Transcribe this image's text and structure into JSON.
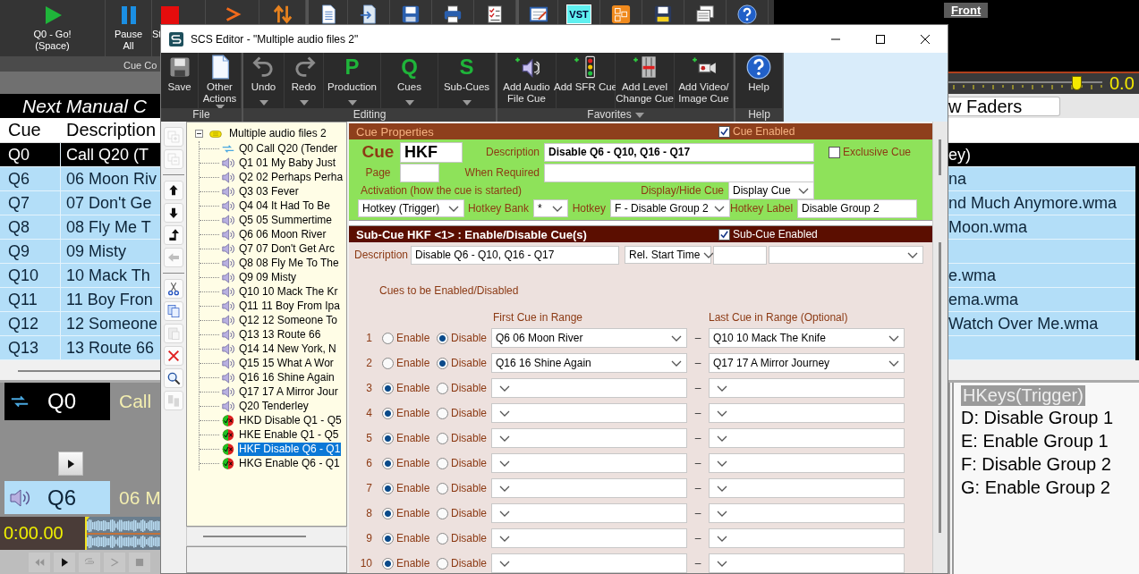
{
  "main_window": {
    "toolbar": {
      "buttons": [
        {
          "kind": "go",
          "label": "Q0 - Go!\n(Space)"
        },
        {
          "kind": "pause",
          "label": "Pause\nAll"
        },
        {
          "kind": "stop",
          "label": "St"
        },
        {
          "kind": "next"
        },
        {
          "kind": "swap"
        },
        {
          "kind": "document",
          "separator_before": true
        },
        {
          "kind": "document_arrow"
        },
        {
          "kind": "save"
        },
        {
          "kind": "print"
        },
        {
          "kind": "checklist"
        },
        {
          "kind": "notepad",
          "separator_before": true
        },
        {
          "kind": "vst",
          "text": "VST"
        },
        {
          "kind": "grid"
        },
        {
          "kind": "save_yellow"
        },
        {
          "kind": "window"
        },
        {
          "kind": "help"
        }
      ],
      "group_label": "Cue Co"
    },
    "front_button": "Front",
    "fader": {
      "level": 0.83,
      "reading": "0.0"
    },
    "faders_button": "w Faders",
    "banner": "Next Manual C",
    "table": {
      "columns": [
        "Cue",
        "Description"
      ],
      "rows": [
        {
          "cue": "Q0",
          "description": "Call Q20 (T",
          "column_3": "ey)",
          "selected": true
        },
        {
          "cue": "Q6",
          "description": "06 Moon Riv",
          "column_3": "na",
          "selected": false
        },
        {
          "cue": "Q7",
          "description": "07 Don't Ge",
          "column_3": "nd Much Anymore.wma",
          "selected": false
        },
        {
          "cue": "Q8",
          "description": "08 Fly Me T",
          "column_3": "Moon.wma",
          "selected": false
        },
        {
          "cue": "Q9",
          "description": "09 Misty",
          "selected": false
        },
        {
          "cue": "Q10",
          "description": "10 Mack Th",
          "column_3": "e.wma",
          "selected": false
        },
        {
          "cue": "Q11",
          "description": "11 Boy Fron",
          "column_3": "ema.wma",
          "selected": false
        },
        {
          "cue": "Q12",
          "description": "12 Someone",
          "column_3": "Watch Over Me.wma",
          "selected": false
        },
        {
          "cue": "Q13",
          "description": "13 Route 66",
          "selected": false
        }
      ]
    },
    "now_playing": [
      {
        "kind": "call",
        "cue": "Q0",
        "title": "Call"
      },
      {
        "kind": "audio",
        "cue": "Q6",
        "title": "06 M"
      }
    ],
    "time": "0:00.00",
    "transport": [
      {
        "kind": "rewind",
        "disabled": true
      },
      {
        "kind": "play",
        "disabled": false
      },
      {
        "kind": "loop",
        "disabled": true
      },
      {
        "kind": "next",
        "disabled": true
      },
      {
        "kind": "stop",
        "disabled": true
      }
    ],
    "hotkeys": {
      "title": "HKeys(Trigger)",
      "items": [
        "D: Disable Group 1",
        "E: Enable Group 1",
        "F: Disable Group 2",
        "G: Enable Group 2"
      ]
    }
  },
  "editor": {
    "title": "SCS Editor - \"Multiple audio files 2\"",
    "ribbon": [
      {
        "label": "File",
        "buttons": [
          {
            "kind": "save",
            "label": "Save"
          },
          {
            "kind": "document",
            "label": "Other\nActions",
            "dropdown": true
          }
        ]
      },
      {
        "label": "Editing",
        "buttons": [
          {
            "kind": "undo",
            "label": "Undo",
            "dropdown": true
          },
          {
            "kind": "redo",
            "label": "Redo",
            "dropdown": true
          },
          {
            "kind": "letter",
            "glyph": "P",
            "label": "Production",
            "dropdown": true
          },
          {
            "kind": "letter",
            "glyph": "Q",
            "label": "Cues",
            "dropdown": true
          },
          {
            "kind": "letter",
            "glyph": "S",
            "label": "Sub-Cues",
            "dropdown": true
          }
        ]
      },
      {
        "label": "Favorites",
        "dropdown": true,
        "buttons": [
          {
            "kind": "add_audio",
            "label": "Add Audio\nFile Cue"
          },
          {
            "kind": "add_sfr",
            "label": "Add SFR Cue"
          },
          {
            "kind": "add_level",
            "label": "Add Level\nChange Cue"
          },
          {
            "kind": "add_video",
            "label": "Add Video/\nImage Cue"
          }
        ]
      },
      {
        "label": "Help",
        "buttons": [
          {
            "kind": "help",
            "label": "Help"
          }
        ]
      }
    ],
    "side_tools": [
      {
        "kind": "add",
        "disabled": true
      },
      {
        "kind": "remove",
        "disabled": true,
        "separator_after": true
      },
      {
        "kind": "up",
        "disabled": false
      },
      {
        "kind": "down",
        "disabled": false
      },
      {
        "kind": "promote",
        "disabled": false
      },
      {
        "kind": "left",
        "disabled": true,
        "separator_after": true
      },
      {
        "kind": "cut",
        "disabled": false
      },
      {
        "kind": "copy",
        "disabled": false
      },
      {
        "kind": "paste",
        "disabled": true
      },
      {
        "kind": "delete",
        "disabled": false
      },
      {
        "kind": "find",
        "disabled": false
      },
      {
        "kind": "move",
        "disabled": true
      }
    ],
    "tree": {
      "label": "Multiple audio files 2",
      "expanded": true,
      "children": [
        {
          "kind": "call",
          "label": "Q0 Call Q20 (Tender",
          "selected": false
        },
        {
          "kind": "audio",
          "label": "Q1 01 My Baby Just",
          "selected": false
        },
        {
          "kind": "audio",
          "label": "Q2 02 Perhaps Perha",
          "selected": false
        },
        {
          "kind": "audio",
          "label": "Q3 03 Fever",
          "selected": false
        },
        {
          "kind": "audio",
          "label": "Q4 04 It Had To Be",
          "selected": false
        },
        {
          "kind": "audio",
          "label": "Q5 05 Summertime",
          "selected": false
        },
        {
          "kind": "audio",
          "label": "Q6 06 Moon River",
          "selected": false
        },
        {
          "kind": "audio",
          "label": "Q7 07 Don't Get Arc",
          "selected": false
        },
        {
          "kind": "audio",
          "label": "Q8 08 Fly Me To The",
          "selected": false
        },
        {
          "kind": "audio",
          "label": "Q9 09 Misty",
          "selected": false
        },
        {
          "kind": "audio",
          "label": "Q10 10 Mack The Kr",
          "selected": false
        },
        {
          "kind": "audio",
          "label": "Q11 11 Boy From Ipa",
          "selected": false
        },
        {
          "kind": "audio",
          "label": "Q12 12 Someone To",
          "selected": false
        },
        {
          "kind": "audio",
          "label": "Q13 13 Route 66",
          "selected": false
        },
        {
          "kind": "audio",
          "label": "Q14 14 New York, N",
          "selected": false
        },
        {
          "kind": "audio",
          "label": "Q15 15 What A Wor",
          "selected": false
        },
        {
          "kind": "audio",
          "label": "Q16 16 Shine Again",
          "selected": false
        },
        {
          "kind": "audio",
          "label": "Q17 17 A Mirror Jour",
          "selected": false
        },
        {
          "kind": "audio",
          "label": "Q20 Tenderley",
          "selected": false
        },
        {
          "kind": "enable",
          "label": "HKD Disable Q1 - Q5",
          "selected": false
        },
        {
          "kind": "enable",
          "label": "HKE Enable Q1 - Q5",
          "selected": false
        },
        {
          "kind": "enable",
          "label": "HKF Disable Q6 - Q1",
          "selected": true
        },
        {
          "kind": "enable",
          "label": "HKG Enable Q6 - Q1",
          "selected": false
        }
      ]
    },
    "cue_properties": {
      "title": "Cue Properties",
      "enabled": {
        "label": "Cue Enabled",
        "checked": true
      },
      "cue_label": "Cue",
      "cue": "HKF",
      "page_label": "Page",
      "description_label": "Description",
      "description": "Disable Q6 - Q10, Q16 - Q17",
      "when_required_label": "When Required",
      "exclusive": {
        "label": "Exclusive Cue",
        "checked": false
      },
      "activation_label": "Activation (how the cue is started)",
      "activation": "Hotkey (Trigger)",
      "display_label": "Display/Hide Cue",
      "display": "Display Cue",
      "hotkey_bank_label": "Hotkey Bank",
      "hotkey_bank": "*",
      "hotkey_caption": "Hotkey",
      "hotkey": "F - Disable Group 2",
      "hotkey_label_caption": "Hotkey Label",
      "hotkey_label": "Disable Group 2"
    },
    "sub_cue": {
      "title": "Sub-Cue HKF <1> : Enable/Disable Cue(s)",
      "enabled": {
        "label": "Sub-Cue Enabled",
        "checked": true
      },
      "description_label": "Description",
      "description": "Disable Q6 - Q10, Q16 - Q17",
      "start": "Rel. Start Time",
      "section_title": "Cues to be Enabled/Disabled",
      "columns": [
        "First Cue in Range",
        "Last Cue in Range (Optional)"
      ],
      "rows": [
        {
          "number": "1",
          "options": [
            {
              "label": "Enable",
              "selected": false
            },
            {
              "label": "Disable",
              "selected": true
            }
          ],
          "first": "Q6 06 Moon River",
          "separator": "–",
          "last": "Q10 10 Mack The Knife"
        },
        {
          "number": "2",
          "options": [
            {
              "label": "Enable",
              "selected": false
            },
            {
              "label": "Disable",
              "selected": true
            }
          ],
          "first": "Q16 16 Shine Again",
          "separator": "–",
          "last": "Q17 17 A Mirror Journey"
        },
        {
          "number": "3",
          "options": [
            {
              "label": "Enable",
              "selected": true
            },
            {
              "label": "Disable",
              "selected": false
            }
          ],
          "separator": "–"
        },
        {
          "number": "4",
          "options": [
            {
              "label": "Enable",
              "selected": true
            },
            {
              "label": "Disable",
              "selected": false
            }
          ],
          "separator": "–"
        },
        {
          "number": "5",
          "options": [
            {
              "label": "Enable",
              "selected": true
            },
            {
              "label": "Disable",
              "selected": false
            }
          ],
          "separator": "–"
        },
        {
          "number": "6",
          "options": [
            {
              "label": "Enable",
              "selected": true
            },
            {
              "label": "Disable",
              "selected": false
            }
          ],
          "separator": "–"
        },
        {
          "number": "7",
          "options": [
            {
              "label": "Enable",
              "selected": true
            },
            {
              "label": "Disable",
              "selected": false
            }
          ],
          "separator": "–"
        },
        {
          "number": "8",
          "options": [
            {
              "label": "Enable",
              "selected": true
            },
            {
              "label": "Disable",
              "selected": false
            }
          ],
          "separator": "–"
        },
        {
          "number": "9",
          "options": [
            {
              "label": "Enable",
              "selected": true
            },
            {
              "label": "Disable",
              "selected": false
            }
          ],
          "separator": "–"
        },
        {
          "number": "10",
          "options": [
            {
              "label": "Enable",
              "selected": true
            },
            {
              "label": "Disable",
              "selected": false
            }
          ],
          "separator": "–"
        }
      ]
    }
  }
}
